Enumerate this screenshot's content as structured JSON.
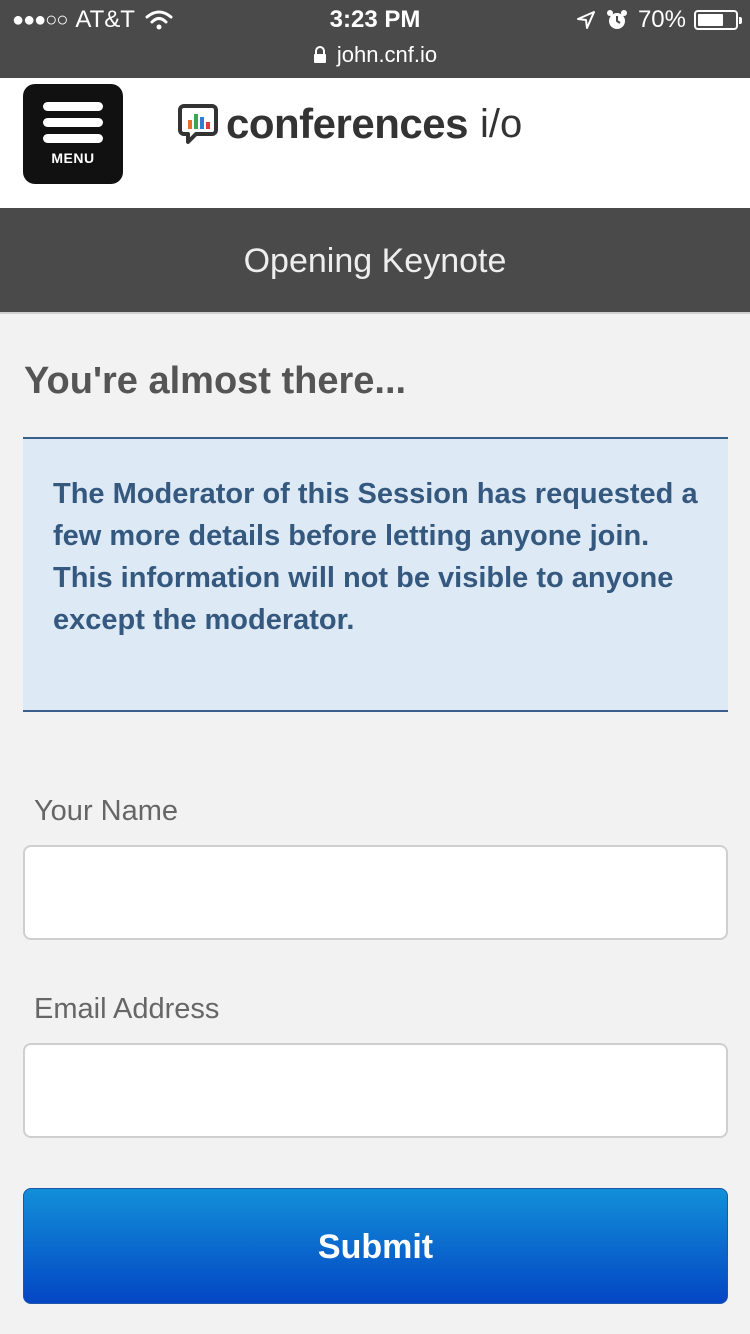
{
  "status_bar": {
    "signal": "●●●○○",
    "carrier": "AT&T",
    "time": "3:23 PM",
    "battery_percent": "70%",
    "battery_level": 0.7,
    "url": "john.cnf.io"
  },
  "header": {
    "menu_label": "MENU",
    "logo_text": "conferences",
    "logo_suffix": "i/o"
  },
  "session": {
    "title": "Opening Keynote"
  },
  "form": {
    "heading": "You're almost there...",
    "notice": "The Moderator of this Session has requested a few more details before letting anyone join. This information will not be visible to anyone except the moderator.",
    "name_label": "Your Name",
    "name_value": "",
    "email_label": "Email Address",
    "email_value": "",
    "submit_label": "Submit"
  },
  "colors": {
    "status_bar_bg": "#4a4a4a",
    "title_bar_bg": "#4a4a4a",
    "notice_bg": "#dde9f5",
    "notice_text": "#35587f",
    "submit_top": "#128fd8",
    "submit_bottom": "#0446c4"
  }
}
